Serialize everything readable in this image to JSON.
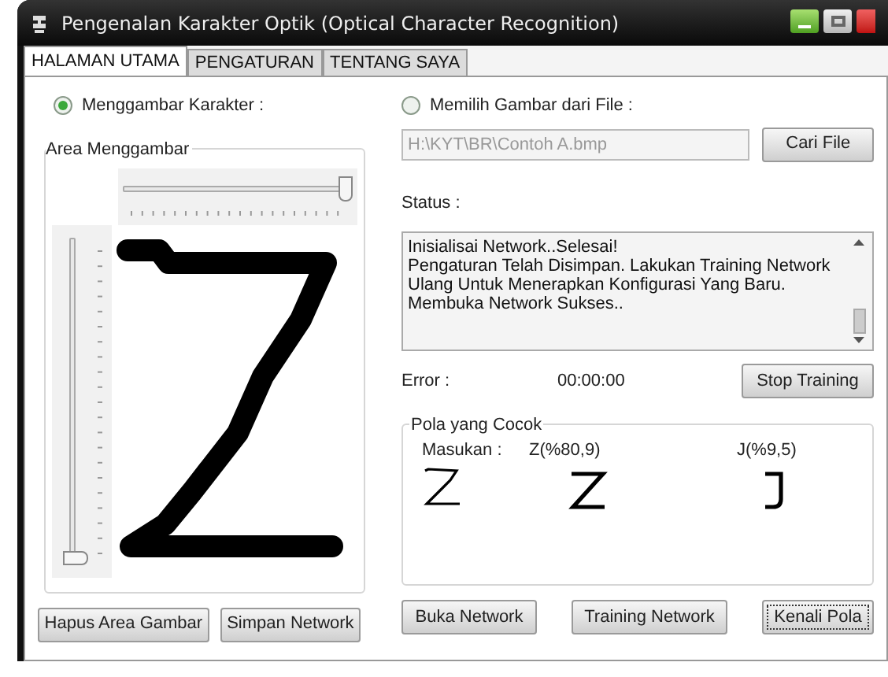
{
  "window": {
    "title": "Pengenalan Karakter Optik (Optical Character Recognition)"
  },
  "tabs": [
    {
      "label": "HALAMAN UTAMA",
      "selected": true
    },
    {
      "label": "PENGATURAN",
      "selected": false
    },
    {
      "label": "TENTANG SAYA",
      "selected": false
    }
  ],
  "draw_mode": {
    "label": "Menggambar Karakter :",
    "selected": true
  },
  "drawing_area": {
    "title": "Area Menggambar",
    "h_slider": {
      "level": 1.0
    },
    "v_slider": {
      "level": 0.0
    }
  },
  "file_mode": {
    "label": "Memilih Gambar dari File :",
    "selected": false
  },
  "file_path": {
    "value": "H:\\KYT\\BR\\Contoh A.bmp"
  },
  "browse_button": "Cari File",
  "status": {
    "label": "Status :",
    "lines": [
      "Inisialisai Network..Selesai!",
      "Pengaturan Telah Disimpan. Lakukan Training Network Ulang Untuk Menerapkan Konfigurasi Yang Baru.",
      "Membuka Network Sukses.."
    ]
  },
  "error": {
    "label": "Error :",
    "time": "00:00:00"
  },
  "stop_button": "Stop Training",
  "matches": {
    "title": "Pola yang Cocok",
    "input_label": "Masukan :",
    "results": [
      "Z(%80,9)",
      "J(%9,5)"
    ]
  },
  "left_buttons": [
    "Hapus Area Gambar",
    "Simpan Network"
  ],
  "right_buttons": [
    {
      "label": "Buka Network",
      "focused": false
    },
    {
      "label": "Training Network",
      "focused": false
    },
    {
      "label": "Kenali Pola",
      "focused": true
    }
  ]
}
